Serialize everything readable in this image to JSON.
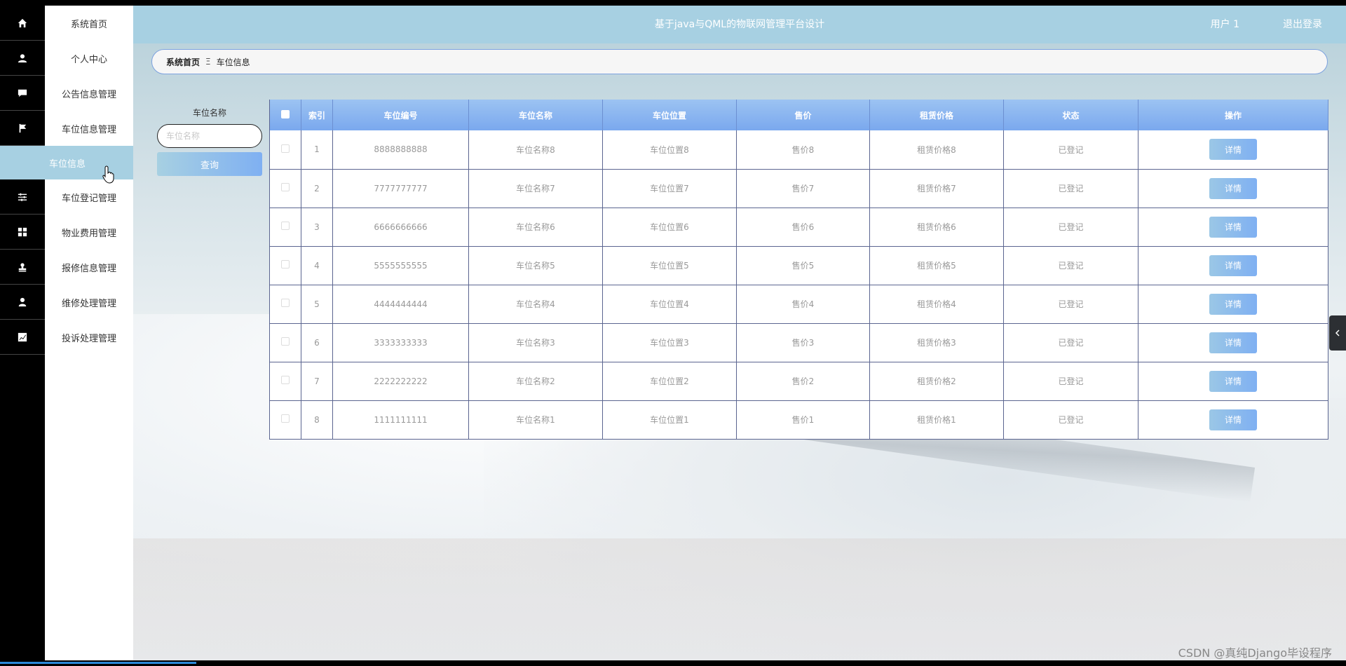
{
  "header": {
    "title": "基于java与QML的物联网管理平台设计",
    "user": "用户 1",
    "logout": "退出登录"
  },
  "sidebar": {
    "items": [
      {
        "label": "系统首页",
        "icon": "home-icon"
      },
      {
        "label": "个人中心",
        "icon": "user-icon"
      },
      {
        "label": "公告信息管理",
        "icon": "chat-icon"
      },
      {
        "label": "车位信息管理",
        "icon": "flag-icon"
      },
      {
        "label": "车位信息",
        "icon": "",
        "active": true
      },
      {
        "label": "车位登记管理",
        "icon": "sliders-icon"
      },
      {
        "label": "物业费用管理",
        "icon": "grid-icon"
      },
      {
        "label": "报修信息管理",
        "icon": "stamp-icon"
      },
      {
        "label": "维修处理管理",
        "icon": "person-icon"
      },
      {
        "label": "投诉处理管理",
        "icon": "chart-icon"
      }
    ]
  },
  "breadcrumb": {
    "home": "系统首页",
    "separator": "Ξ",
    "current": "车位信息"
  },
  "search": {
    "label": "车位名称",
    "placeholder": "车位名称",
    "button": "查询"
  },
  "table": {
    "columns": [
      "索引",
      "车位编号",
      "车位名称",
      "车位位置",
      "售价",
      "租赁价格",
      "状态",
      "操作"
    ],
    "rows": [
      {
        "index": "1",
        "code": "8888888888",
        "name": "车位名称8",
        "location": "车位位置8",
        "price": "售价8",
        "rent": "租赁价格8",
        "status": "已登记",
        "action": "详情"
      },
      {
        "index": "2",
        "code": "7777777777",
        "name": "车位名称7",
        "location": "车位位置7",
        "price": "售价7",
        "rent": "租赁价格7",
        "status": "已登记",
        "action": "详情"
      },
      {
        "index": "3",
        "code": "6666666666",
        "name": "车位名称6",
        "location": "车位位置6",
        "price": "售价6",
        "rent": "租赁价格6",
        "status": "已登记",
        "action": "详情"
      },
      {
        "index": "4",
        "code": "5555555555",
        "name": "车位名称5",
        "location": "车位位置5",
        "price": "售价5",
        "rent": "租赁价格5",
        "status": "已登记",
        "action": "详情"
      },
      {
        "index": "5",
        "code": "4444444444",
        "name": "车位名称4",
        "location": "车位位置4",
        "price": "售价4",
        "rent": "租赁价格4",
        "status": "已登记",
        "action": "详情"
      },
      {
        "index": "6",
        "code": "3333333333",
        "name": "车位名称3",
        "location": "车位位置3",
        "price": "售价3",
        "rent": "租赁价格3",
        "status": "已登记",
        "action": "详情"
      },
      {
        "index": "7",
        "code": "2222222222",
        "name": "车位名称2",
        "location": "车位位置2",
        "price": "售价2",
        "rent": "租赁价格2",
        "status": "已登记",
        "action": "详情"
      },
      {
        "index": "8",
        "code": "1111111111",
        "name": "车位名称1",
        "location": "车位位置1",
        "price": "售价1",
        "rent": "租赁价格1",
        "status": "已登记",
        "action": "详情"
      }
    ]
  },
  "watermark": "CSDN @真纯Django毕设程序",
  "colors": {
    "accent": "#a7d0e2",
    "header_gradient": "#7aa8ee",
    "button": "#7fb0f2"
  }
}
